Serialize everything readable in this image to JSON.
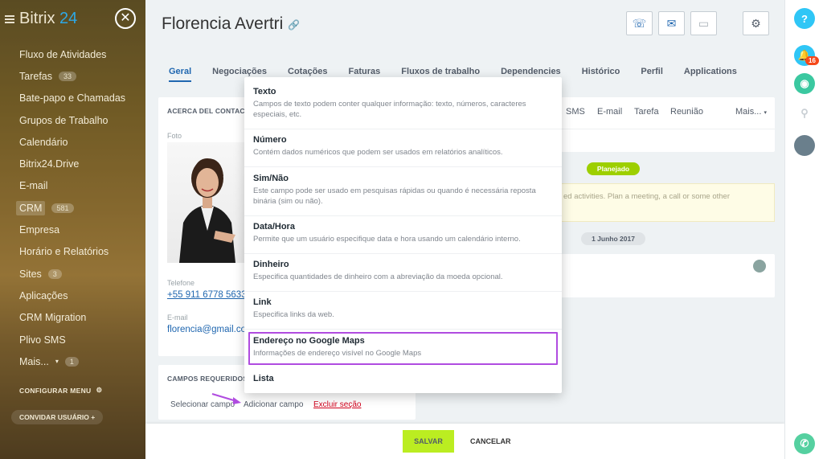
{
  "sidebar": {
    "logo_word": "Bitrix",
    "logo_num": "24",
    "items": [
      {
        "label": "Fluxo de Atividades",
        "count": ""
      },
      {
        "label": "Tarefas",
        "count": "33"
      },
      {
        "label": "Bate-papo e Chamadas",
        "count": ""
      },
      {
        "label": "Grupos de Trabalho",
        "count": ""
      },
      {
        "label": "Calendário",
        "count": ""
      },
      {
        "label": "Bitrix24.Drive",
        "count": ""
      },
      {
        "label": "E-mail",
        "count": ""
      },
      {
        "label": "CRM",
        "count": "581"
      },
      {
        "label": "Empresa",
        "count": ""
      },
      {
        "label": "Horário e Relatórios",
        "count": ""
      },
      {
        "label": "Sites",
        "count": "3"
      },
      {
        "label": "Aplicações",
        "count": ""
      },
      {
        "label": "CRM Migration",
        "count": ""
      },
      {
        "label": "Plivo SMS",
        "count": ""
      },
      {
        "label": "Mais...",
        "count": "1"
      }
    ],
    "configure_menu": "CONFIGURAR MENU",
    "invite_users": "CONVIDAR USUÁRIO"
  },
  "header": {
    "title": "Florencia Avertri"
  },
  "tabs": [
    "Geral",
    "Negociações",
    "Cotações",
    "Faturas",
    "Fluxos de trabalho",
    "Dependencies",
    "Histórico",
    "Perfil",
    "Applications"
  ],
  "about": {
    "head": "ACERCA DEL CONTACTO",
    "photo_label": "Foto",
    "phone_label": "Telefone",
    "phone_value": "+55 911 6778 5633",
    "email_label": "E-mail",
    "email_value": "florencia@gmail.com"
  },
  "required": {
    "head": "CAMPOS REQUERIDOS",
    "select_field": "Selecionar campo",
    "add_field": "Adicionar campo",
    "delete_section": "Excluir seção"
  },
  "timeline": {
    "tabs": [
      "SMS",
      "E-mail",
      "Tarefa",
      "Reunião",
      "Mais..."
    ],
    "planned_badge": "Planejado",
    "empty_text": "ed activities. Plan a meeting, a call or some other",
    "date_badge": "1 Junho 2017"
  },
  "popup": {
    "options": [
      {
        "title": "Texto",
        "desc": "Campos de texto podem conter qualquer informação: texto, números, caracteres especiais, etc."
      },
      {
        "title": "Número",
        "desc": "Contém dados numéricos que podem ser usados em relatórios analíticos."
      },
      {
        "title": "Sim/Não",
        "desc": "Este campo pode ser usado em pesquisas rápidas ou quando é necessária reposta binária (sim ou não)."
      },
      {
        "title": "Data/Hora",
        "desc": "Permite que um usuário especifique data e hora usando um calendário interno."
      },
      {
        "title": "Dinheiro",
        "desc": "Especifica quantidades de dinheiro com a abreviação da moeda opcional."
      },
      {
        "title": "Link",
        "desc": "Especifica links da web."
      },
      {
        "title": "Endereço no Google Maps",
        "desc": "Informações de endereço visível no Google Maps"
      },
      {
        "title": "Lista",
        "desc": ""
      }
    ]
  },
  "footer": {
    "save": "SALVAR",
    "cancel": "CANCELAR"
  },
  "rail": {
    "help": "?",
    "notif_count": "16"
  },
  "colors": {
    "accent": "#2067b0",
    "save_green": "#bbed21",
    "highlight": "#b04ce0",
    "planned": "#9dcf00"
  }
}
